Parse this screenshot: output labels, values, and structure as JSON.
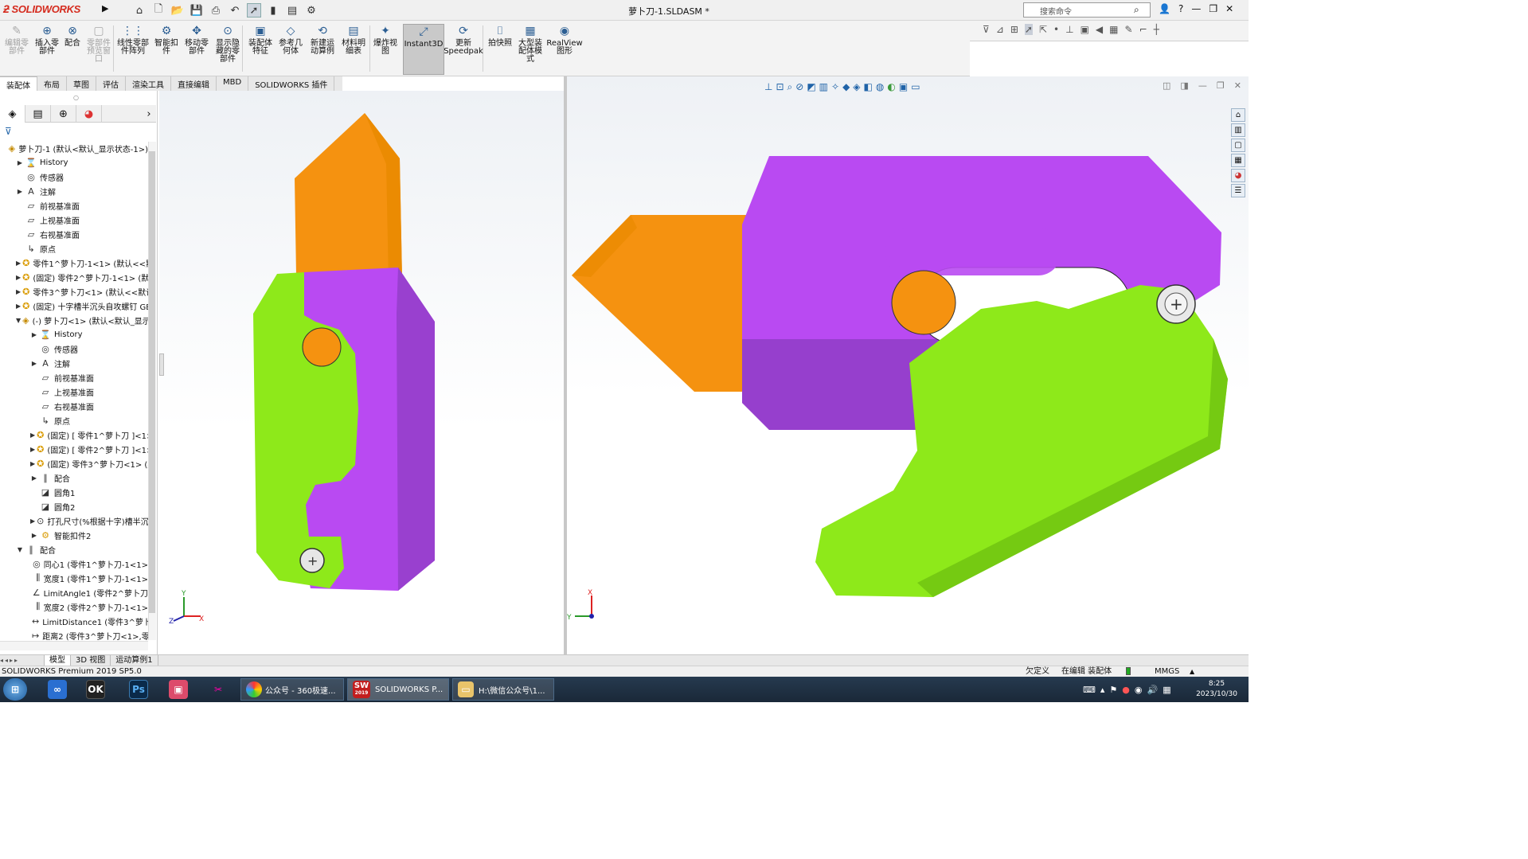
{
  "app": {
    "name": "SOLIDWORKS",
    "doc_title": "萝卜刀-1.SLDASM *",
    "search_placeholder": "搜索命令"
  },
  "ribbon": [
    {
      "label": "编辑零\n部件",
      "disabled": true,
      "icon": "edit-part-icon"
    },
    {
      "label": "插入零\n部件",
      "disabled": false,
      "icon": "insert-component-icon"
    },
    {
      "label": "配合",
      "disabled": false,
      "icon": "mate-icon"
    },
    {
      "label": "零部件\n预览窗\n口",
      "disabled": true,
      "icon": "preview-icon"
    },
    {
      "label": "线性零部\n件阵列",
      "disabled": false,
      "icon": "linear-pattern-icon"
    },
    {
      "label": "智能扣\n件",
      "disabled": false,
      "icon": "smart-fastener-icon"
    },
    {
      "label": "移动零\n部件",
      "disabled": false,
      "icon": "move-component-icon"
    },
    {
      "label": "显示隐\n藏的零\n部件",
      "disabled": false,
      "icon": "show-hidden-icon"
    },
    {
      "label": "装配体\n特征",
      "disabled": false,
      "icon": "assembly-feature-icon"
    },
    {
      "label": "参考几\n何体",
      "disabled": false,
      "icon": "reference-geometry-icon"
    },
    {
      "label": "新建运\n动算例",
      "disabled": false,
      "icon": "motion-study-icon"
    },
    {
      "label": "材料明\n细表",
      "disabled": false,
      "icon": "bom-icon"
    },
    {
      "label": "爆炸视\n图",
      "disabled": false,
      "icon": "exploded-view-icon"
    },
    {
      "label": "Instant3D",
      "disabled": false,
      "active": true,
      "icon": "instant3d-icon"
    },
    {
      "label": "更新\nSpeedpak",
      "disabled": false,
      "icon": "speedpak-icon"
    },
    {
      "label": "拍快照",
      "disabled": false,
      "icon": "snapshot-icon"
    },
    {
      "label": "大型装\n配体模\n式",
      "disabled": false,
      "icon": "large-assembly-icon"
    },
    {
      "label": "RealView\n图形",
      "disabled": false,
      "icon": "realview-icon"
    }
  ],
  "tabs": [
    "装配体",
    "布局",
    "草图",
    "评估",
    "渲染工具",
    "直接编辑",
    "MBD",
    "SOLIDWORKS 插件"
  ],
  "active_tab": 0,
  "tree": [
    {
      "lvl": 0,
      "tw": "",
      "icon": "assembly-icon",
      "label": "萝卜刀-1 (默认<默认_显示状态-1>)"
    },
    {
      "lvl": 1,
      "tw": "▶",
      "icon": "history-icon",
      "label": "History"
    },
    {
      "lvl": 1,
      "tw": "",
      "icon": "sensor-icon",
      "label": "传感器"
    },
    {
      "lvl": 1,
      "tw": "▶",
      "icon": "annotation-icon",
      "label": "注解"
    },
    {
      "lvl": 1,
      "tw": "",
      "icon": "plane-icon",
      "label": "前视基准面"
    },
    {
      "lvl": 1,
      "tw": "",
      "icon": "plane-icon",
      "label": "上视基准面"
    },
    {
      "lvl": 1,
      "tw": "",
      "icon": "plane-icon",
      "label": "右视基准面"
    },
    {
      "lvl": 1,
      "tw": "",
      "icon": "origin-icon",
      "label": "原点"
    },
    {
      "lvl": 1,
      "tw": "▶",
      "icon": "part-icon",
      "label": "零件1^萝卜刀-1<1> (默认<<默"
    },
    {
      "lvl": 1,
      "tw": "▶",
      "icon": "part-icon",
      "label": "(固定) 零件2^萝卜刀-1<1> (默认"
    },
    {
      "lvl": 1,
      "tw": "▶",
      "icon": "part-icon",
      "label": "零件3^萝卜刀<1> (默认<<默认"
    },
    {
      "lvl": 1,
      "tw": "▶",
      "icon": "part-icon",
      "label": "(固定) 十字槽半沉头自攻螺钉 GB"
    },
    {
      "lvl": 1,
      "tw": "▼",
      "icon": "subassembly-icon",
      "label": "(-) 萝卜刀<1> (默认<默认_显示"
    },
    {
      "lvl": 2,
      "tw": "▶",
      "icon": "history-icon",
      "label": "History"
    },
    {
      "lvl": 2,
      "tw": "",
      "icon": "sensor-icon",
      "label": "传感器"
    },
    {
      "lvl": 2,
      "tw": "▶",
      "icon": "annotation-icon",
      "label": "注解"
    },
    {
      "lvl": 2,
      "tw": "",
      "icon": "plane-icon",
      "label": "前视基准面"
    },
    {
      "lvl": 2,
      "tw": "",
      "icon": "plane-icon",
      "label": "上视基准面"
    },
    {
      "lvl": 2,
      "tw": "",
      "icon": "plane-icon",
      "label": "右视基准面"
    },
    {
      "lvl": 2,
      "tw": "",
      "icon": "origin-icon",
      "label": "原点"
    },
    {
      "lvl": 2,
      "tw": "▶",
      "icon": "part-icon",
      "label": "(固定) [ 零件1^萝卜刀 ]<1>"
    },
    {
      "lvl": 2,
      "tw": "▶",
      "icon": "part-icon",
      "label": "(固定) [ 零件2^萝卜刀 ]<1>"
    },
    {
      "lvl": 2,
      "tw": "▶",
      "icon": "part-icon",
      "label": "(固定) 零件3^萝卜刀<1> (默"
    },
    {
      "lvl": 2,
      "tw": "▶",
      "icon": "mate-icon",
      "label": "配合"
    },
    {
      "lvl": 2,
      "tw": "",
      "icon": "fillet-icon",
      "label": "圆角1"
    },
    {
      "lvl": 2,
      "tw": "",
      "icon": "fillet-icon",
      "label": "圆角2"
    },
    {
      "lvl": 2,
      "tw": "▶",
      "icon": "hole-icon",
      "label": "打孔尺寸(%根据十字)槽半沉"
    },
    {
      "lvl": 2,
      "tw": "▶",
      "icon": "smart-fastener-icon",
      "label": "智能扣件2"
    },
    {
      "lvl": 1,
      "tw": "▼",
      "icon": "mate-icon",
      "label": "配合"
    },
    {
      "lvl": 2,
      "tw": "",
      "icon": "concentric-icon",
      "label": "同心1 (零件1^萝卜刀-1<1>"
    },
    {
      "lvl": 2,
      "tw": "",
      "icon": "width-icon",
      "label": "宽度1 (零件1^萝卜刀-1<1>"
    },
    {
      "lvl": 2,
      "tw": "",
      "icon": "limit-angle-icon",
      "label": "LimitAngle1 (零件2^萝卜刀"
    },
    {
      "lvl": 2,
      "tw": "",
      "icon": "width-icon",
      "label": "宽度2 (零件2^萝卜刀-1<1>"
    },
    {
      "lvl": 2,
      "tw": "",
      "icon": "limit-distance-icon",
      "label": "LimitDistance1 (零件3^萝卜"
    },
    {
      "lvl": 2,
      "tw": "",
      "icon": "distance-icon",
      "label": "距离2 (零件3^萝卜刀<1>,零"
    }
  ],
  "bottom_tabs": [
    "模型",
    "3D 视图",
    "运动算例1"
  ],
  "status": {
    "left": "SOLIDWORKS Premium 2019 SP5.0",
    "undefined": "欠定义",
    "editing": "在编辑 装配体",
    "units": "MMGS"
  },
  "taskbar": {
    "tasks": [
      "公众号 - 360极速...",
      "SOLIDWORKS P...",
      "H:\\微信公众号\\1..."
    ],
    "sw_version": "2019",
    "time": "8:25",
    "date": "2023/10/30"
  },
  "colors": {
    "orange": "#f59210",
    "purple": "#b94af2",
    "green": "#8ee91a",
    "accent": "#d52b1e"
  }
}
